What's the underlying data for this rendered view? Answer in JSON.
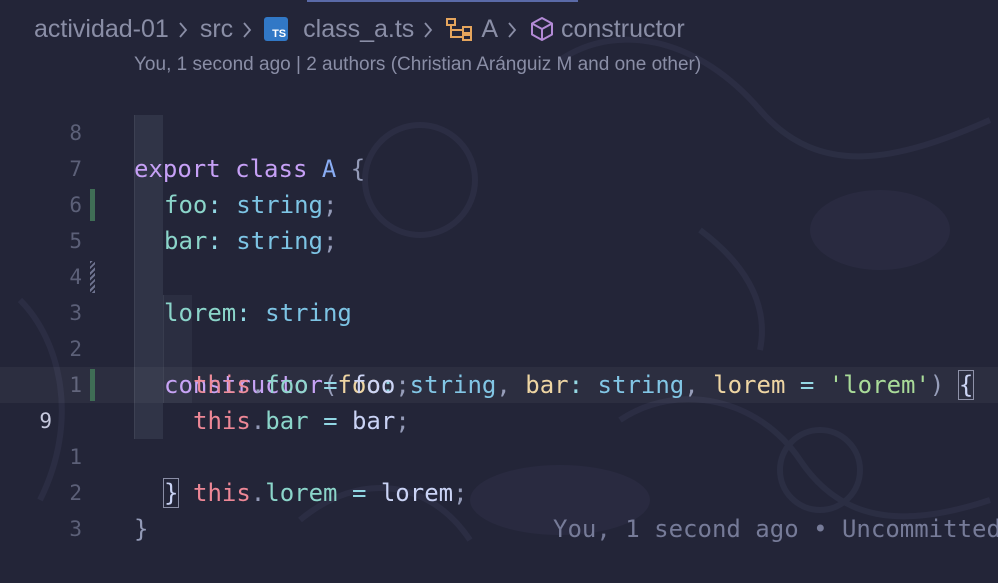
{
  "breadcrumb": {
    "items": [
      {
        "label": "actividad-01",
        "icon": "none"
      },
      {
        "label": "src",
        "icon": "none"
      },
      {
        "label": "class_a.ts",
        "icon": "typescript-file-icon",
        "icon_text": "TS"
      },
      {
        "label": "A",
        "icon": "class-symbol-icon"
      },
      {
        "label": "constructor",
        "icon": "method-cube-icon"
      }
    ]
  },
  "blame_header": "You, 1 second ago | 2 authors (Christian Aránguiz M and one other)",
  "inline_blame": "You, 1 second ago • Uncommitted",
  "line_numbers": [
    "8",
    "7",
    "6",
    "5",
    "4",
    "3",
    "2",
    "1",
    "9",
    "1",
    "2",
    "3"
  ],
  "code": {
    "l1": {
      "export": "export",
      "class": "class",
      "name": "A",
      "brace": "{"
    },
    "l2": {
      "prop": "foo",
      "colon": ":",
      "type": "string",
      "semi": ";"
    },
    "l3": {
      "prop": "bar",
      "colon": ":",
      "type": "string",
      "semi": ";"
    },
    "l4": {
      "prop": "lorem",
      "colon": ":",
      "type": "string"
    },
    "l6": {
      "ctor": "constructor",
      "open": "(",
      "p1": "foo",
      "c1": ":",
      "t1": "string",
      "comma1": ",",
      "p2": "bar",
      "c2": ":",
      "t2": "string",
      "comma2": ",",
      "p3": "lorem",
      "eq": "=",
      "default": "'lorem'",
      "close": ")",
      "brace": "{"
    },
    "l7": {
      "this": "this",
      "dot": ".",
      "prop": "foo",
      "eq": "=",
      "val": "foo",
      "semi": ";"
    },
    "l8": {
      "this": "this",
      "dot": ".",
      "prop": "bar",
      "eq": "=",
      "val": "bar",
      "semi": ";"
    },
    "l9": {
      "this": "this",
      "dot": ".",
      "prop": "lorem",
      "eq": "=",
      "val": "lorem",
      "semi": ";"
    },
    "l10": {
      "brace": "}"
    },
    "l11": {
      "brace": "}"
    }
  },
  "colors": {
    "background": "#232538",
    "keyword": "#c6a0f6",
    "class_name": "#8aadf4",
    "property": "#8bd5ca",
    "type": "#7dc4e4",
    "parameter": "#eed49f",
    "string": "#a6da95",
    "this": "#ed8796",
    "git_added": "#3f6d55",
    "typescript_badge": "#3178c6"
  }
}
